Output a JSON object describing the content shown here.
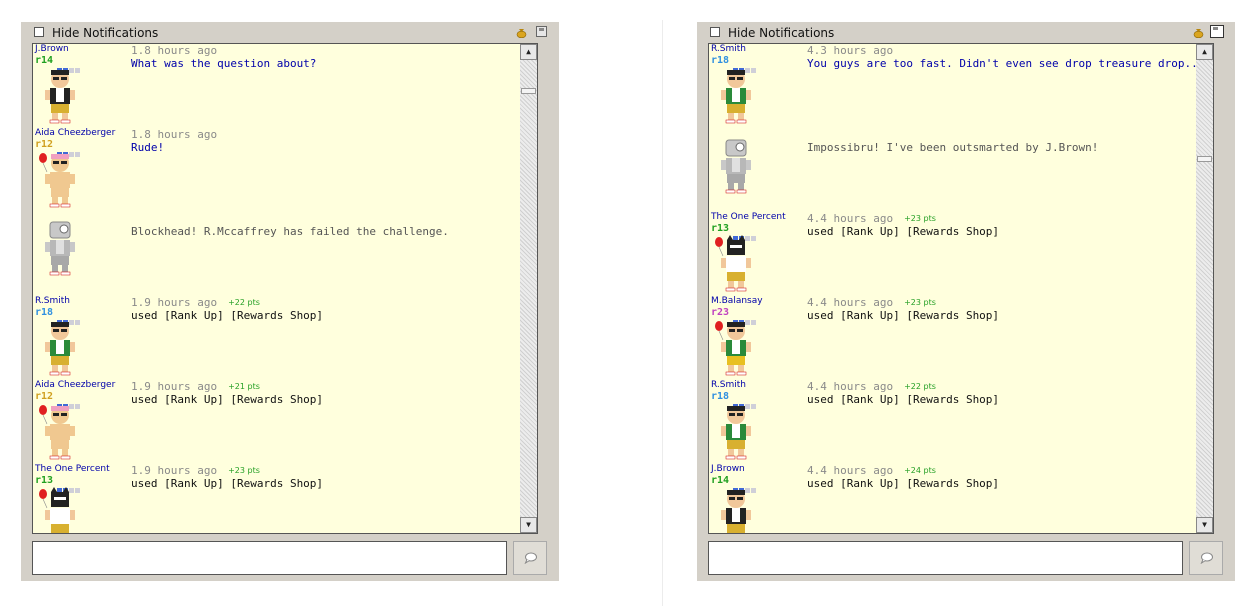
{
  "colors": {
    "panel": "#d4d0c8",
    "chat_bg": "#ffffdd",
    "name": "#0000aa",
    "points": "#26a026"
  },
  "left": {
    "hide_label": "Hide Notifications",
    "messages": [
      {
        "name": "J.Brown",
        "rank": "r14",
        "rank_color": "#20a020",
        "time": "1.8 hours ago",
        "pts": "",
        "text": "What was the question about?",
        "style": "blue",
        "avatar": "tux"
      },
      {
        "name": "Aida Cheezberger",
        "rank": "r12",
        "rank_color": "#d0a020",
        "time": "1.8 hours ago",
        "pts": "",
        "text": "Rude!",
        "style": "blue",
        "avatar": "ginger"
      },
      {
        "name": "",
        "rank": "",
        "rank_color": "",
        "time": "",
        "pts": "",
        "text": "Blockhead! R.Mccaffrey has failed the challenge.",
        "style": "grey",
        "avatar": "robot"
      },
      {
        "name": "R.Smith",
        "rank": "r18",
        "rank_color": "#3090e0",
        "time": "1.9 hours ago",
        "pts": "+22 pts",
        "text": "used [Rank Up] [Rewards Shop]",
        "style": "black",
        "avatar": "green"
      },
      {
        "name": "Aida Cheezberger",
        "rank": "r12",
        "rank_color": "#d0a020",
        "time": "1.9 hours ago",
        "pts": "+21 pts",
        "text": "used [Rank Up] [Rewards Shop]",
        "style": "black",
        "avatar": "ginger"
      },
      {
        "name": "The One Percent",
        "rank": "r13",
        "rank_color": "#20a020",
        "time": "1.9 hours ago",
        "pts": "+23 pts",
        "text": "used [Rank Up] [Rewards Shop]",
        "style": "black",
        "avatar": "cat"
      }
    ]
  },
  "right": {
    "hide_label": "Hide Notifications",
    "messages": [
      {
        "name": "R.Smith",
        "rank": "r18",
        "rank_color": "#3090e0",
        "time": "4.3 hours ago",
        "pts": "",
        "text": "You guys are too fast. Didn't even see drop treasure drop...",
        "style": "blue",
        "avatar": "green"
      },
      {
        "name": "",
        "rank": "",
        "rank_color": "",
        "time": "",
        "pts": "",
        "text": "Impossibru! I've been outsmarted by J.Brown!",
        "style": "grey",
        "avatar": "robot"
      },
      {
        "name": "The One Percent",
        "rank": "r13",
        "rank_color": "#20a020",
        "time": "4.4 hours ago",
        "pts": "+23 pts",
        "text": "used [Rank Up] [Rewards Shop]",
        "style": "black",
        "avatar": "cat"
      },
      {
        "name": "M.Balansay",
        "rank": "r23",
        "rank_color": "#c040c0",
        "time": "4.4 hours ago",
        "pts": "+23 pts",
        "text": "used [Rank Up] [Rewards Shop]",
        "style": "black",
        "avatar": "girl"
      },
      {
        "name": "R.Smith",
        "rank": "r18",
        "rank_color": "#3090e0",
        "time": "4.4 hours ago",
        "pts": "+22 pts",
        "text": "used [Rank Up] [Rewards Shop]",
        "style": "black",
        "avatar": "green"
      },
      {
        "name": "J.Brown",
        "rank": "r14",
        "rank_color": "#20a020",
        "time": "4.4 hours ago",
        "pts": "+24 pts",
        "text": "used [Rank Up] [Rewards Shop]",
        "style": "black",
        "avatar": "tux"
      }
    ]
  },
  "icons": {
    "bag": "money-bag-icon",
    "save": "floppy-icon",
    "send": "speech-bubble-icon",
    "up": "arrow-up-icon",
    "down": "arrow-down-icon"
  }
}
